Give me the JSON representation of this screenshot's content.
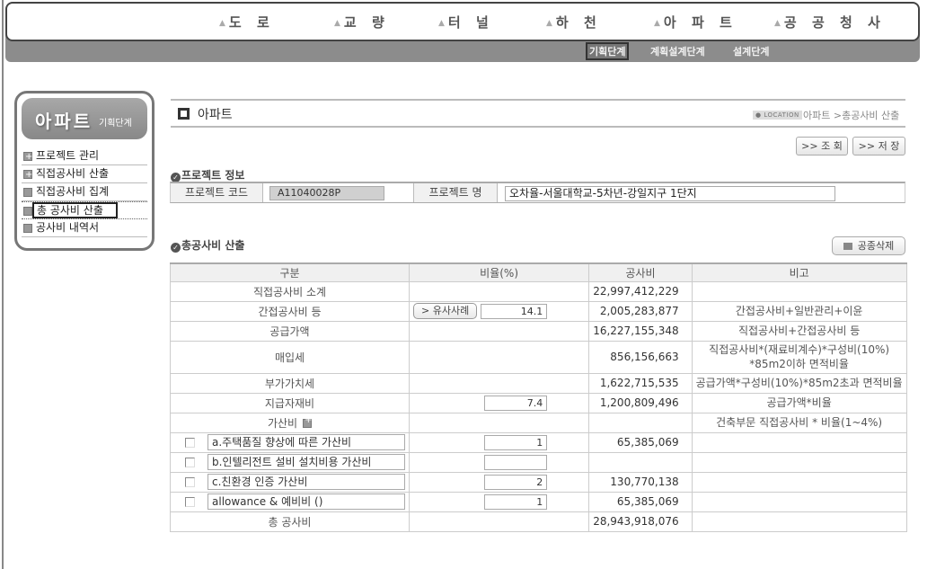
{
  "topnav": {
    "items": [
      {
        "label": "도 로"
      },
      {
        "label": "교 량"
      },
      {
        "label": "터 널"
      },
      {
        "label": "하 천"
      },
      {
        "label": "아 파 트"
      },
      {
        "label": "공 공 청 사"
      }
    ],
    "stages": [
      {
        "label": "기획단계",
        "active": true
      },
      {
        "label": "계획설계단계",
        "active": false
      },
      {
        "label": "설계단계",
        "active": false
      }
    ]
  },
  "sidebar": {
    "title": "아파트",
    "subtitle": "기획단계",
    "items": [
      {
        "label": "프로젝트 관리",
        "icon": "plus-square-icon"
      },
      {
        "label": "직접공사비 산출",
        "icon": "plus-square-icon"
      },
      {
        "label": "직접공사비 집계",
        "icon": "square-icon"
      },
      {
        "label": "총 공사비 산출",
        "icon": "square-icon",
        "active": true
      },
      {
        "label": "공사비 내역서",
        "icon": "square-icon"
      }
    ]
  },
  "header": {
    "title": "아파트",
    "location_badge": "● LOCATION",
    "location_path": "아파트 >총공사비 산출"
  },
  "actions": {
    "search_label": ">> 조 회",
    "save_label": ">> 저 장",
    "delete_work_label": "공종삭제"
  },
  "project": {
    "section_title": "프로젝트 정보",
    "code_label": "프로젝트 코드",
    "code_value": "A11040028P",
    "name_label": "프로젝트 명",
    "name_value": "오차율-서울대학교-5차년-강일지구 1단지"
  },
  "cost": {
    "section_title": "총공사비 산출",
    "headers": [
      "구분",
      "비율(%)",
      "공사비",
      "비고"
    ],
    "similar_case_label": "> 유사사례",
    "rows": [
      {
        "label": "직접공사비 소계",
        "ratio": "",
        "amount": "22,997,412,229",
        "memo": ""
      },
      {
        "label": "간접공사비 등",
        "ratio": "14.1",
        "amount": "2,005,283,877",
        "memo": "간접공사비+일반관리+이윤"
      },
      {
        "label": "공급가액",
        "ratio": "",
        "amount": "16,227,155,348",
        "memo": "직접공사비+간접공사비 등"
      },
      {
        "label": "매입세",
        "ratio": "",
        "amount": "856,156,663",
        "memo_line1": "직접공사비*(재료비계수)*구성비(10%)",
        "memo_line2": "*85m2이하 면적비율"
      },
      {
        "label": "부가가치세",
        "ratio": "",
        "amount": "1,622,715,535",
        "memo": "공급가액*구성비(10%)*85m2초과 면적비율"
      },
      {
        "label": "지급자재비",
        "ratio": "7.4",
        "amount": "1,200,809,496",
        "memo": "공급가액*비율"
      },
      {
        "label": "가산비",
        "ratio": "",
        "amount": "",
        "memo": "건축부문 직접공사비 * 비율(1~4%)"
      }
    ],
    "addons": [
      {
        "name": "a.주택품질 향상에 따른 가산비",
        "ratio": "1",
        "amount": "65,385,069",
        "checked": false
      },
      {
        "name": "b.인텔리전트 설비 설치비용 가산비",
        "ratio": "",
        "amount": "",
        "checked": false
      },
      {
        "name": "c.친환경 인증 가산비",
        "ratio": "2",
        "amount": "130,770,138",
        "checked": false
      },
      {
        "name": "allowance & 예비비 ()",
        "ratio": "1",
        "amount": "65,385,069",
        "checked": false
      }
    ],
    "total": {
      "label": "총 공사비",
      "amount": "28,943,918,076"
    }
  }
}
